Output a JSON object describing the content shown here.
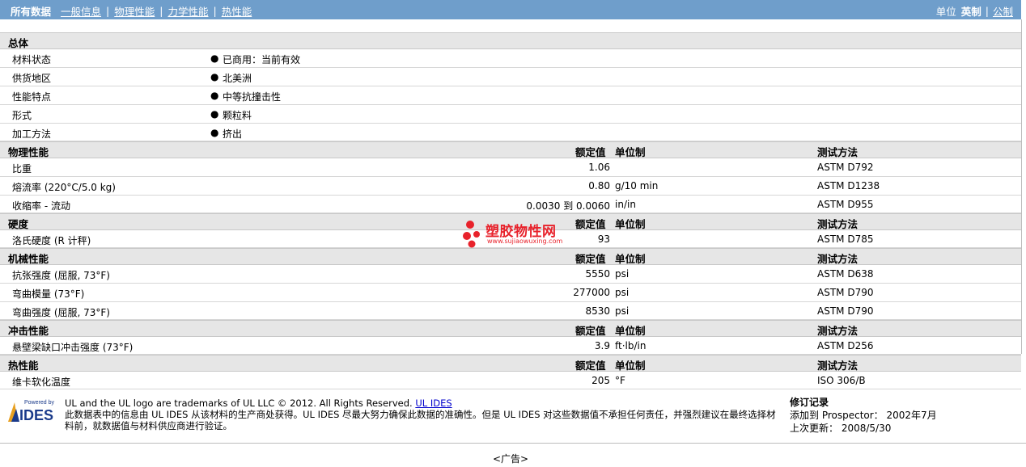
{
  "nav": {
    "all_data": "所有数据",
    "links": [
      "一般信息",
      "物理性能",
      "力学性能",
      "热性能"
    ],
    "unit_label": "单位",
    "unit_current": "英制",
    "unit_other": "公制"
  },
  "headers": {
    "value": "额定值",
    "unit": "单位制",
    "test": "测试方法"
  },
  "general": {
    "title": "总体",
    "rows": [
      {
        "key": "材料状态",
        "bullet": "●",
        "value": "已商用：当前有效"
      },
      {
        "key": "供货地区",
        "bullet": "●",
        "value": "北美洲"
      },
      {
        "key": "性能特点",
        "bullet": "●",
        "value": "中等抗撞击性"
      },
      {
        "key": "形式",
        "bullet": "●",
        "value": "颗粒料"
      },
      {
        "key": "加工方法",
        "bullet": "●",
        "value": "挤出"
      }
    ]
  },
  "physical": {
    "title": "物理性能",
    "rows": [
      {
        "key": "比重",
        "num": "1.06",
        "unit": "",
        "test": "ASTM D792"
      },
      {
        "key": "熔流率  (220°C/5.0 kg)",
        "num": "0.80",
        "unit": "g/10 min",
        "test": "ASTM D1238"
      },
      {
        "key": "收缩率  - 流动",
        "num": "0.0030 到  0.0060",
        "unit": "in/in",
        "test": "ASTM D955"
      }
    ]
  },
  "hardness": {
    "title": "硬度",
    "rows": [
      {
        "key": "洛氏硬度  (R 计秤)",
        "num": "93",
        "unit": "",
        "test": "ASTM D785"
      }
    ]
  },
  "mechanical": {
    "title": "机械性能",
    "rows": [
      {
        "key": "抗张强度  (屈服, 73°F)",
        "num": "5550",
        "unit": "psi",
        "test": "ASTM D638"
      },
      {
        "key": "弯曲模量  (73°F)",
        "num": "277000",
        "unit": "psi",
        "test": "ASTM D790"
      },
      {
        "key": "弯曲强度  (屈服, 73°F)",
        "num": "8530",
        "unit": "psi",
        "test": "ASTM D790"
      }
    ]
  },
  "impact": {
    "title": "冲击性能",
    "rows": [
      {
        "key": "悬壁梁缺口冲击强度  (73°F)",
        "num": "3.9",
        "unit": "ft·lb/in",
        "test": "ASTM D256"
      }
    ]
  },
  "thermal": {
    "title": "热性能",
    "rows": [
      {
        "key": "维卡软化温度",
        "num": "205",
        "unit": "°F",
        "test": "ISO 306/B"
      }
    ]
  },
  "watermark": {
    "cn": "塑胶物性网",
    "en": "www.sujiaowuxing.com"
  },
  "footer": {
    "logo_top": "Powered by",
    "logo_main": "IDES",
    "line1": "UL and the UL logo are trademarks of UL LLC © 2012. All Rights Reserved.",
    "line1_link": "UL IDES",
    "line2": "此数据表中的信息由  UL IDES 从该材料的生产商处获得。UL IDES 尽最大努力确保此数据的准确性。但是  UL IDES 对这些数据值不承担任何责任，并强烈建议在最终选择材料前，就数据值与材料供应商进行验证。",
    "rev_title": "修订记录",
    "rev_added": "添加到  Prospector：  2002年7月",
    "rev_updated": "上次更新：   2008/5/30",
    "ad": "<广告>"
  },
  "colors": {
    "topbar": "#6f9ecb",
    "section_bg": "#e6e6e6",
    "watermark": "#e8222b",
    "link": "#0000cc"
  }
}
